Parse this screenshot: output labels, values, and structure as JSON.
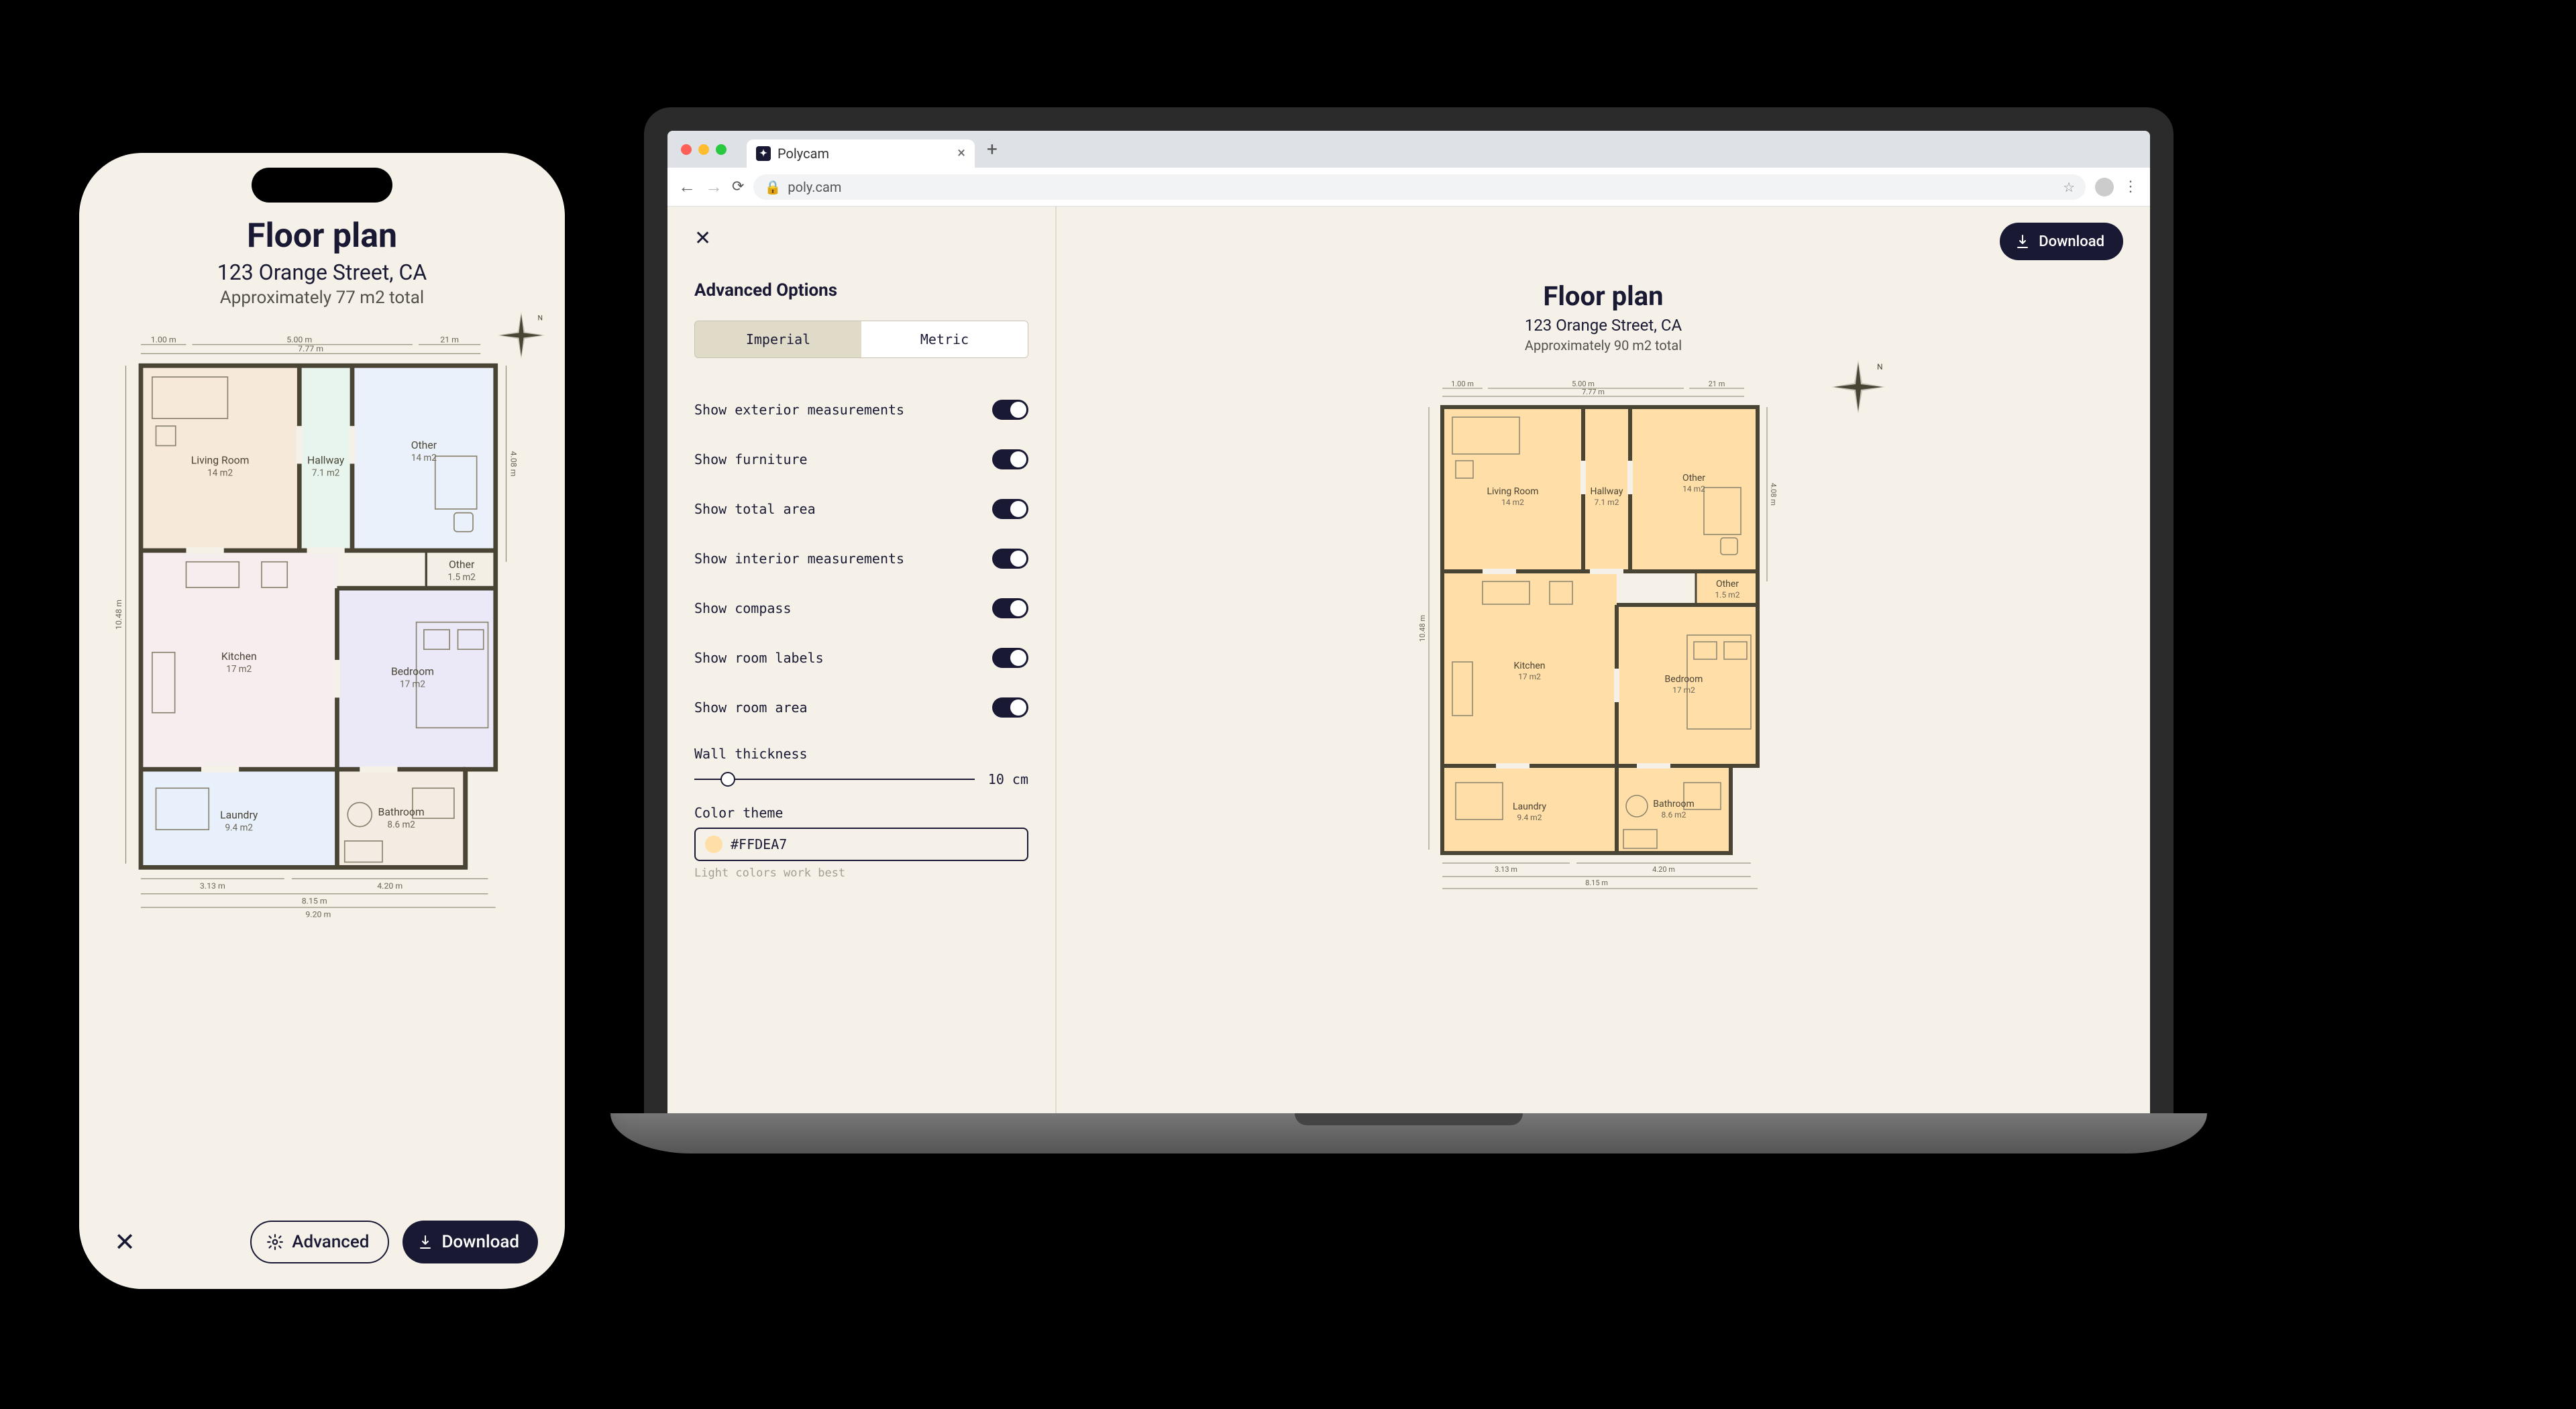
{
  "browser": {
    "tab_title": "Polycam",
    "url": "poly.cam"
  },
  "desktop": {
    "close_icon": "close-icon",
    "download_label": "Download",
    "sidebar": {
      "title": "Advanced Options",
      "segmented": {
        "imperial": "Imperial",
        "metric": "Metric",
        "active": "Imperial"
      },
      "options": [
        {
          "label": "Show exterior measurements",
          "on": true
        },
        {
          "label": "Show furniture",
          "on": true
        },
        {
          "label": "Show total area",
          "on": true
        },
        {
          "label": "Show interior measurements",
          "on": true
        },
        {
          "label": "Show compass",
          "on": true
        },
        {
          "label": "Show room labels",
          "on": true
        },
        {
          "label": "Show room area",
          "on": true
        }
      ],
      "wall_thickness_label": "Wall thickness",
      "wall_thickness_value": "10 cm",
      "color_theme_label": "Color theme",
      "color_hex": "#FFDEA7",
      "color_hint": "Light colors work best"
    },
    "canvas": {
      "title": "Floor plan",
      "address": "123 Orange Street, CA",
      "area": "Approximately 90 m2 total"
    }
  },
  "phone": {
    "title": "Floor plan",
    "address": "123 Orange Street, CA",
    "area": "Approximately 77 m2 total",
    "advanced_label": "Advanced",
    "download_label": "Download"
  },
  "floorplan": {
    "rooms": [
      {
        "name": "Living Room",
        "area": "14 m2"
      },
      {
        "name": "Hallway",
        "area": "7.1 m2"
      },
      {
        "name": "Other",
        "area": "14 m2"
      },
      {
        "name": "Other",
        "area": "1.5 m2"
      },
      {
        "name": "Kitchen",
        "area": "17 m2"
      },
      {
        "name": "Bedroom",
        "area": "17 m2"
      },
      {
        "name": "Laundry",
        "area": "9.4 m2"
      },
      {
        "name": "Bathroom",
        "area": "8.6 m2"
      }
    ],
    "dimensions": {
      "top_left": "1.00 m",
      "top_main": "5.00 m",
      "top_overall_inner": "7.77 m",
      "top_right": "21 m",
      "right_upper": "4.08 m",
      "left_full": "10.48 m",
      "bottom_left_inner": "3.13 m",
      "bottom_right_inner": "4.20 m",
      "bottom_overall": "8.15 m",
      "bottom_overall_outer": "9.20 m"
    },
    "palette_desktop": "#FFDEA7",
    "palette_phone": {
      "living": "#f7e9da",
      "hallway": "#e7f5ee",
      "other1": "#eaf1fb",
      "other2": "#f3efe7",
      "kitchen": "#f6eeee",
      "bedroom": "#ebe9f8",
      "laundry": "#e8f0fb",
      "bathroom": "#f4ece3"
    }
  }
}
